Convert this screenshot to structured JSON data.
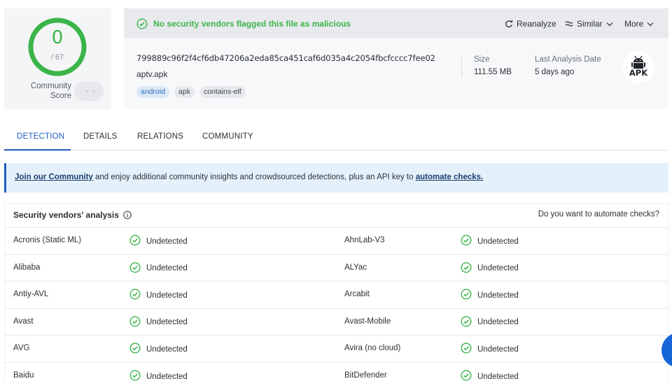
{
  "score": {
    "value": "0",
    "denominator": "/ 67",
    "community_label": "Community Score",
    "color": "#3bb54a"
  },
  "banner": {
    "message": "No security vendors flagged this file as malicious"
  },
  "actions": {
    "reanalyze": "Reanalyze",
    "similar": "Similar",
    "more": "More"
  },
  "file": {
    "hash": "799889c96f2f4cf6db47206a2eda85ca451caf6d035a4c2054fbcfcccc7fee02",
    "name": "aptv.apk",
    "tags": [
      "android",
      "apk",
      "contains-elf"
    ]
  },
  "meta": {
    "size_label": "Size",
    "size_value": "111.55 MB",
    "date_label": "Last Analysis Date",
    "date_value": "5 days ago"
  },
  "file_type_icon": {
    "text": "APK",
    "icon": "android-robot-icon"
  },
  "tabs": [
    "DETECTION",
    "DETAILS",
    "RELATIONS",
    "COMMUNITY"
  ],
  "info_banner": {
    "link1": "Join our Community",
    "middle": " and enjoy additional community insights and crowdsourced detections, plus an API key to ",
    "link2": "automate checks."
  },
  "analysis": {
    "title": "Security vendors' analysis",
    "right_link": "Do you want to automate checks?",
    "rows": [
      [
        {
          "vendor": "Acronis (Static ML)",
          "result": "Undetected"
        },
        {
          "vendor": "AhnLab-V3",
          "result": "Undetected"
        }
      ],
      [
        {
          "vendor": "Alibaba",
          "result": "Undetected"
        },
        {
          "vendor": "ALYac",
          "result": "Undetected"
        }
      ],
      [
        {
          "vendor": "Antiy-AVL",
          "result": "Undetected"
        },
        {
          "vendor": "Arcabit",
          "result": "Undetected"
        }
      ],
      [
        {
          "vendor": "Avast",
          "result": "Undetected"
        },
        {
          "vendor": "Avast-Mobile",
          "result": "Undetected"
        }
      ],
      [
        {
          "vendor": "AVG",
          "result": "Undetected"
        },
        {
          "vendor": "Avira (no cloud)",
          "result": "Undetected"
        }
      ],
      [
        {
          "vendor": "Baidu",
          "result": "Undetected"
        },
        {
          "vendor": "BitDefender",
          "result": "Undetected"
        }
      ]
    ]
  },
  "colors": {
    "accent": "#1f5fbf",
    "clean": "#3bb54a",
    "fab": "#1565d8"
  }
}
